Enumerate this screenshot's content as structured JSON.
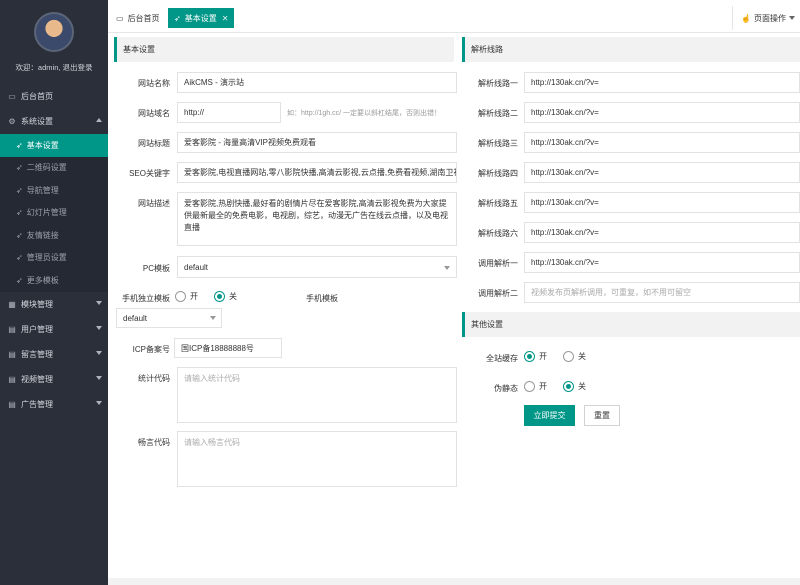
{
  "sidebar": {
    "user_line": "欢迎：admin, 退出登录",
    "home": "后台首页",
    "system": "系统设置",
    "sub": [
      "基本设置",
      "二维码设置",
      "导航管理",
      "幻灯片管理",
      "友情链接",
      "管理员设置",
      "更多模板"
    ],
    "groups": [
      "模块管理",
      "用户管理",
      "留言管理",
      "视频管理",
      "广告管理"
    ]
  },
  "tabs": {
    "home": "后台首页",
    "current": "基本设置",
    "page_ops": "页面操作"
  },
  "basic": {
    "title": "基本设置",
    "site_name_label": "网站名称",
    "site_name": "AikCMS - 演示站",
    "domain_label": "网站域名",
    "domain": "http://",
    "domain_hint": "如：http://1gh.cc/ 一定要以斜杠结尾，否则出错！",
    "keywords_label": "网站标题",
    "keywords": "爱客影院 - 海量高清VIP视频免费观看",
    "seo_label": "SEO关键字",
    "seo": "爱客影院,电视直播网站,零八影院快播,高清云影视,云点播,免费看视频,湖南卫视",
    "desc_label": "网站描述",
    "desc": "爱客影院,热剧快播,最好看的剧情片尽在爱客影院,高清云影视免费为大家提供最新最全的免费电影，电视剧，综艺，动漫无广告在线云点播，以及电视直播",
    "pc_label": "PC模板",
    "pc_value": "default",
    "mobile_indep_label": "手机独立模板",
    "on": "开",
    "off": "关",
    "mobile_tpl_label": "手机模板",
    "mobile_value": "default",
    "icp_label": "ICP备案号",
    "icp": "国ICP备18888888号",
    "stats_label": "统计代码",
    "stats_ph": "请输入统计代码",
    "comment_label": "畅言代码",
    "comment_ph": "请输入畅言代码"
  },
  "parse": {
    "title": "解析线路",
    "lines": [
      {
        "label": "解析线路一",
        "value": "http://130ak.cn/?v="
      },
      {
        "label": "解析线路二",
        "value": "http://130ak.cn/?v="
      },
      {
        "label": "解析线路三",
        "value": "http://130ak.cn/?v="
      },
      {
        "label": "解析线路四",
        "value": "http://130ak.cn/?v="
      },
      {
        "label": "解析线路五",
        "value": "http://130ak.cn/?v="
      },
      {
        "label": "解析线路六",
        "value": "http://130ak.cn/?v="
      },
      {
        "label": "调用解析一",
        "value": "http://130ak.cn/?v="
      }
    ],
    "call2_label": "调用解析二",
    "call2_ph": "视频发布页解析调用，可重复，如不用可留空"
  },
  "other": {
    "title": "其他设置",
    "cache_label": "全站缓存",
    "static_label": "伪静态",
    "on": "开",
    "off": "关",
    "submit": "立即提交",
    "reset": "重置"
  },
  "colors": {
    "accent": "#009688",
    "sidebar": "#2b2f3a"
  }
}
